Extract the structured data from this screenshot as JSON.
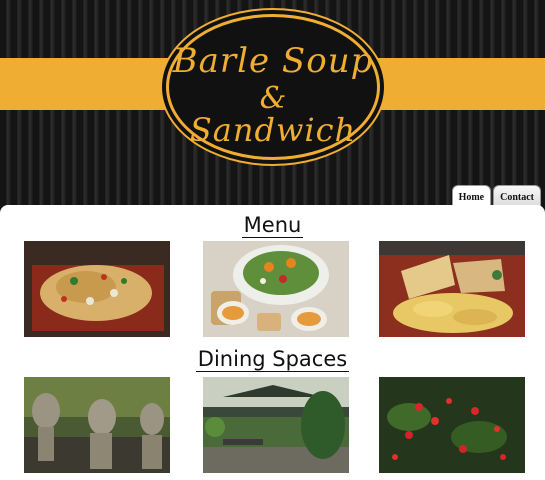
{
  "logo": {
    "line1": "Barle Soup",
    "amp": "&",
    "line2": "Sandwich"
  },
  "nav": {
    "tabs": [
      {
        "label": "Home"
      },
      {
        "label": "Contact"
      }
    ]
  },
  "sections": {
    "menu": {
      "title": "Menu"
    },
    "dining": {
      "title": "Dining Spaces"
    }
  },
  "colors": {
    "accent": "#f0ad34",
    "header_bg": "#1b1b1b"
  }
}
